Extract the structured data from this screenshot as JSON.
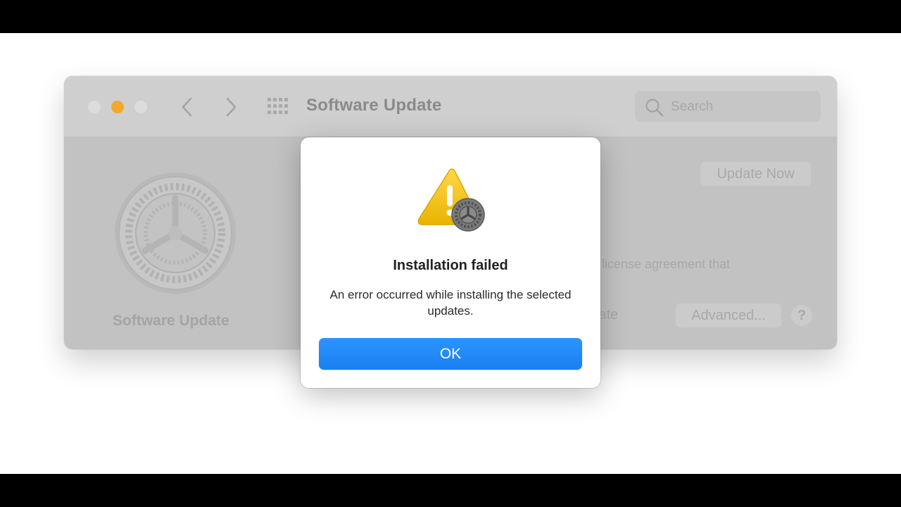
{
  "window": {
    "title": "Software Update",
    "search": {
      "placeholder": "Search"
    },
    "sidebar_label": "Software Update",
    "update_now_label": "Update Now",
    "license_fragment": "l license agreement that",
    "date_fragment": "late",
    "advanced_label": "Advanced...",
    "help_label": "?"
  },
  "dialog": {
    "title": "Installation failed",
    "message": "An error occurred while installing the selected updates.",
    "ok_label": "OK"
  },
  "icons": {
    "traffic_lights": [
      "close-icon",
      "minimize-icon",
      "zoom-icon"
    ],
    "nav": [
      "back-chevron-icon",
      "forward-chevron-icon"
    ],
    "grid": "show-all-grid-icon",
    "search": "search-icon",
    "app": "system-preferences-gear-icon",
    "alert": "warning-triangle-icon"
  },
  "colors": {
    "accent": "#1a7ff2",
    "minimize_light": "#f2a92b",
    "warning": "#f5c518"
  }
}
